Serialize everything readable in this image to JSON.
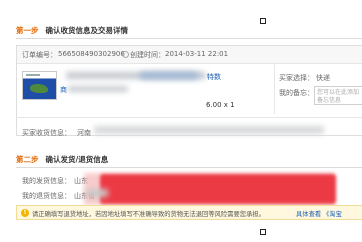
{
  "step1": {
    "number": "第一步",
    "title": "确认收货信息及交易详情"
  },
  "order": {
    "number_label": "订单编号：",
    "number_value": "566508490302906",
    "created_label": "创建时间：",
    "created_value": "2014-03-11 22:01",
    "product_title_visible": "特数",
    "product_subline": "商",
    "price_qty": "6.00 x 1",
    "buyer_choice_label": "买家选择：",
    "buyer_choice_value": "快递",
    "my_remark_label": "我的备忘：",
    "remark_placeholder": "您可以在此添加备忘信息"
  },
  "buyer": {
    "label": "买家收货信息：",
    "value_visible": "河南"
  },
  "step2": {
    "number": "第二步",
    "title": "确认发货/退货信息"
  },
  "shipping": {
    "ship_label": "我的发货信息：",
    "ship_value_visible": "山东",
    "return_label": "我的退货信息：",
    "return_value_visible": "山东省"
  },
  "notice": {
    "icon": "warning-icon",
    "text": "请正确填写退货地址，若因地址填写不准确导致的货物无法退回等风险需要您承担。",
    "link": "具体查看",
    "link_tail": "《淘宝"
  }
}
